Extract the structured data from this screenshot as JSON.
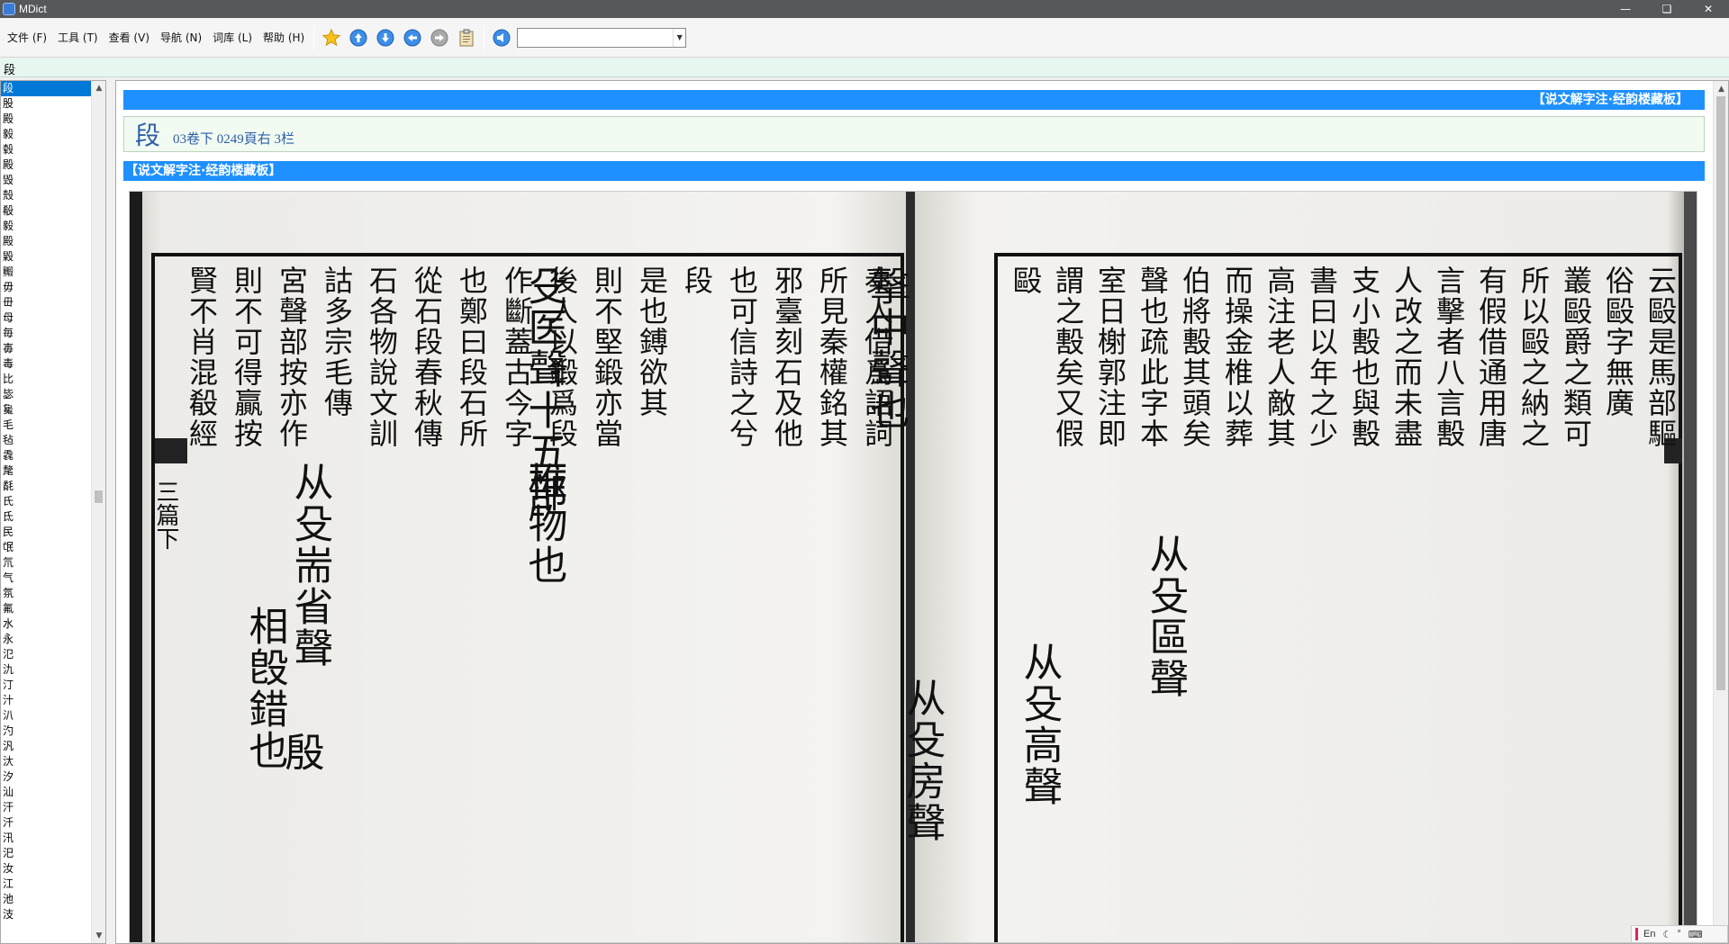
{
  "window": {
    "title": "MDict"
  },
  "menu": [
    "文件 (F)",
    "工具 (T)",
    "查看 (V)",
    "导航 (N)",
    "词库 (L)",
    "帮助 (H)"
  ],
  "toolbar": {
    "icons": [
      "star-icon",
      "arrow-up-icon",
      "arrow-down-icon",
      "arrow-back-icon",
      "arrow-forward-icon",
      "clipboard-icon",
      "speaker-icon"
    ],
    "dictionary_select": ""
  },
  "search": {
    "value": "段"
  },
  "wordlist": {
    "selected": "段",
    "items": [
      "段",
      "股",
      "殿",
      "毅",
      "毂",
      "殿",
      "毁",
      "殼",
      "殽",
      "毅",
      "殿",
      "毇",
      "毈",
      "毋",
      "毌",
      "母",
      "毎",
      "毐",
      "毒",
      "比",
      "毖",
      "毚",
      "毛",
      "毡",
      "毳",
      "氂",
      "氄",
      "氏",
      "氐",
      "民",
      "氓",
      "氘",
      "气",
      "氛",
      "氟",
      "水",
      "永",
      "氾",
      "氿",
      "汀",
      "汁",
      "汃",
      "汋",
      "汎",
      "汏",
      "汐",
      "汕",
      "汗",
      "汘",
      "汛",
      "汜",
      "汝",
      "江",
      "池",
      "汥"
    ]
  },
  "entry": {
    "source_bar": "【说文解字注·经韵楼藏板】",
    "headword": "段",
    "location": "03卷下 0249頁右 3栏",
    "section_bar": "【说文解字注·经韵楼藏板】"
  },
  "scan": {
    "left_cols": [
      "秦人借爲語詞",
      "所見秦權銘其",
      "邪臺刻石及他",
      "也可信詩之兮",
      "段",
      "是也鎛欲其",
      "則不堅鍛亦當",
      "後人以鍛爲段",
      "作斷蓋古今字",
      "也鄭曰段石所",
      "從石段春秋傳",
      "石各物說文訓",
      "詁多宗毛傳",
      "宮聲部按亦作",
      "則不可得贏按",
      "賢不肖混殽經"
    ],
    "left_big": [
      "殳医聲十五部",
      "椎物也",
      "从殳耑省聲",
      "相𣪘錯也",
      "殷"
    ],
    "right_cols": [
      "云毆是馬部驅",
      "俗毆字無廣",
      "叢毆爵之類可",
      "所以毆之納之",
      "有假借通用唐",
      "言擊者八言毄",
      "人改之而未盡",
      "支小毄也與毄",
      "書曰以年之少",
      "高注老人敵其",
      "而操金椎以葬",
      "伯將毄其頭矣",
      "聲也疏此字本",
      "室日榭郭注即",
      "謂之毄矣又假",
      "毆"
    ],
    "right_big": [
      "擊中聲也",
      "从殳區聲",
      "从殳高聲",
      "从殳房聲"
    ],
    "side_label": "三篇下"
  },
  "tray": {
    "lang": "En"
  }
}
